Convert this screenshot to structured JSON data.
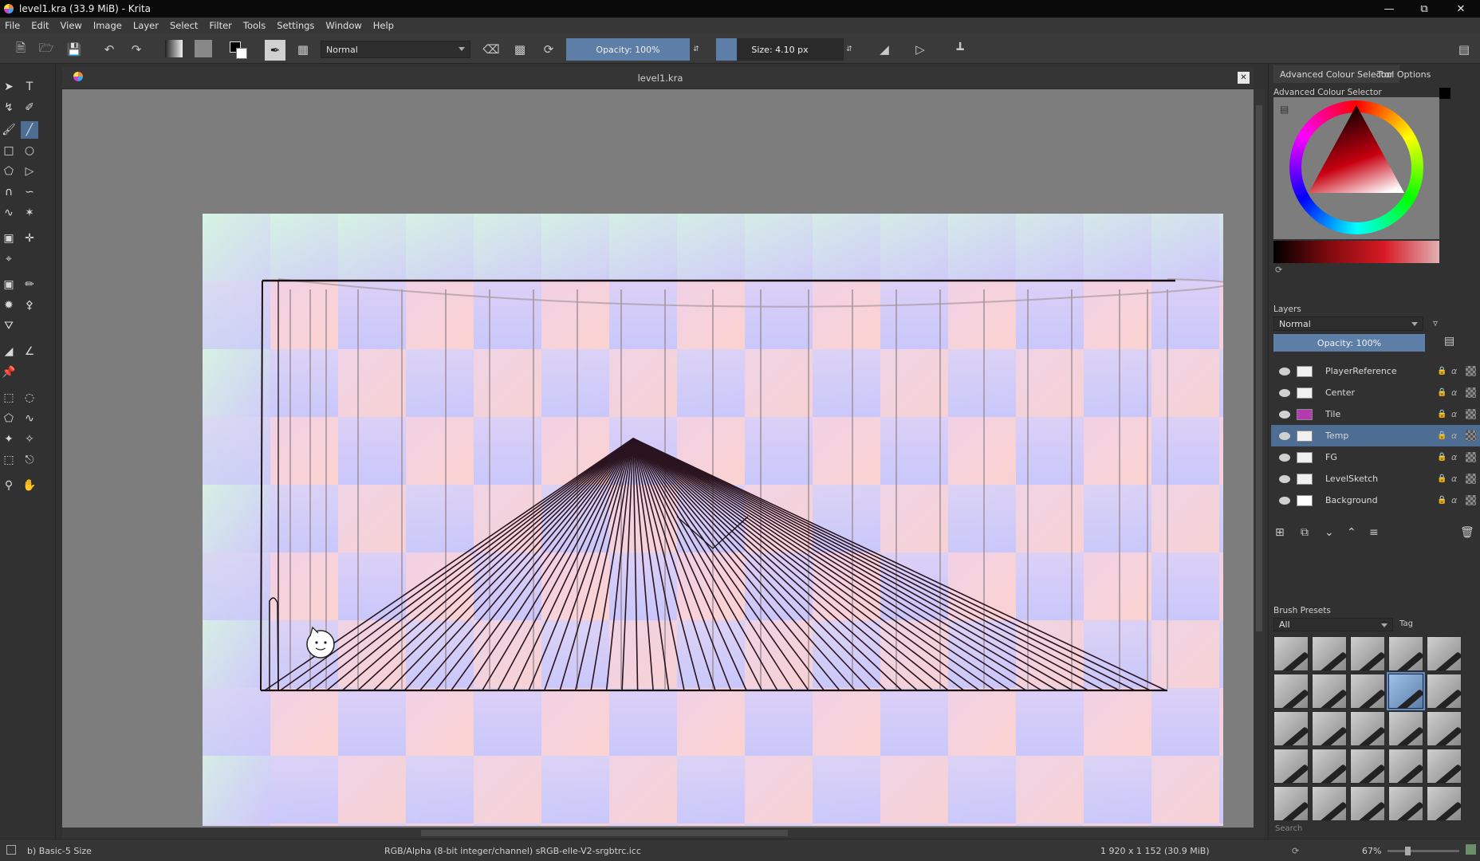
{
  "window": {
    "title": "level1.kra (33.9 MiB)  - Krita"
  },
  "menu": [
    "File",
    "Edit",
    "View",
    "Image",
    "Layer",
    "Select",
    "Filter",
    "Tools",
    "Settings",
    "Window",
    "Help"
  ],
  "toolbar": {
    "blend_mode": "Normal",
    "opacity_label": "Opacity: 100%",
    "opacity": 1.0,
    "size_label": "Size: 4.10 px"
  },
  "document": {
    "tab_title": "level1.kra"
  },
  "colors": {
    "accent": "#4e6d93",
    "slider_fill": "#5d7ea6"
  },
  "right_panel": {
    "tabs": [
      "Advanced Colour Selector",
      "Tool Options"
    ],
    "colour_selector_title": "Advanced Colour Selector",
    "layers_title": "Layers",
    "layers_blend_mode": "Normal",
    "layers_opacity_label": "Opacity:  100%",
    "layers": [
      {
        "name": "PlayerReference",
        "selected": false
      },
      {
        "name": "Center",
        "selected": false
      },
      {
        "name": "Tile",
        "selected": false
      },
      {
        "name": "Temp",
        "selected": true
      },
      {
        "name": "FG",
        "selected": false
      },
      {
        "name": "LevelSketch",
        "selected": false
      },
      {
        "name": "Background",
        "selected": false
      }
    ],
    "brush_presets_title": "Brush Presets",
    "brush_filter": "All",
    "tag_label": "Tag",
    "search_placeholder": "Search"
  },
  "status": {
    "brush": "b) Basic-5 Size",
    "color_profile": "RGB/Alpha (8-bit integer/channel)  sRGB-elle-V2-srgbtrc.icc",
    "image_size": "1 920 x 1 152 (30.9 MiB)",
    "zoom": "67%"
  }
}
